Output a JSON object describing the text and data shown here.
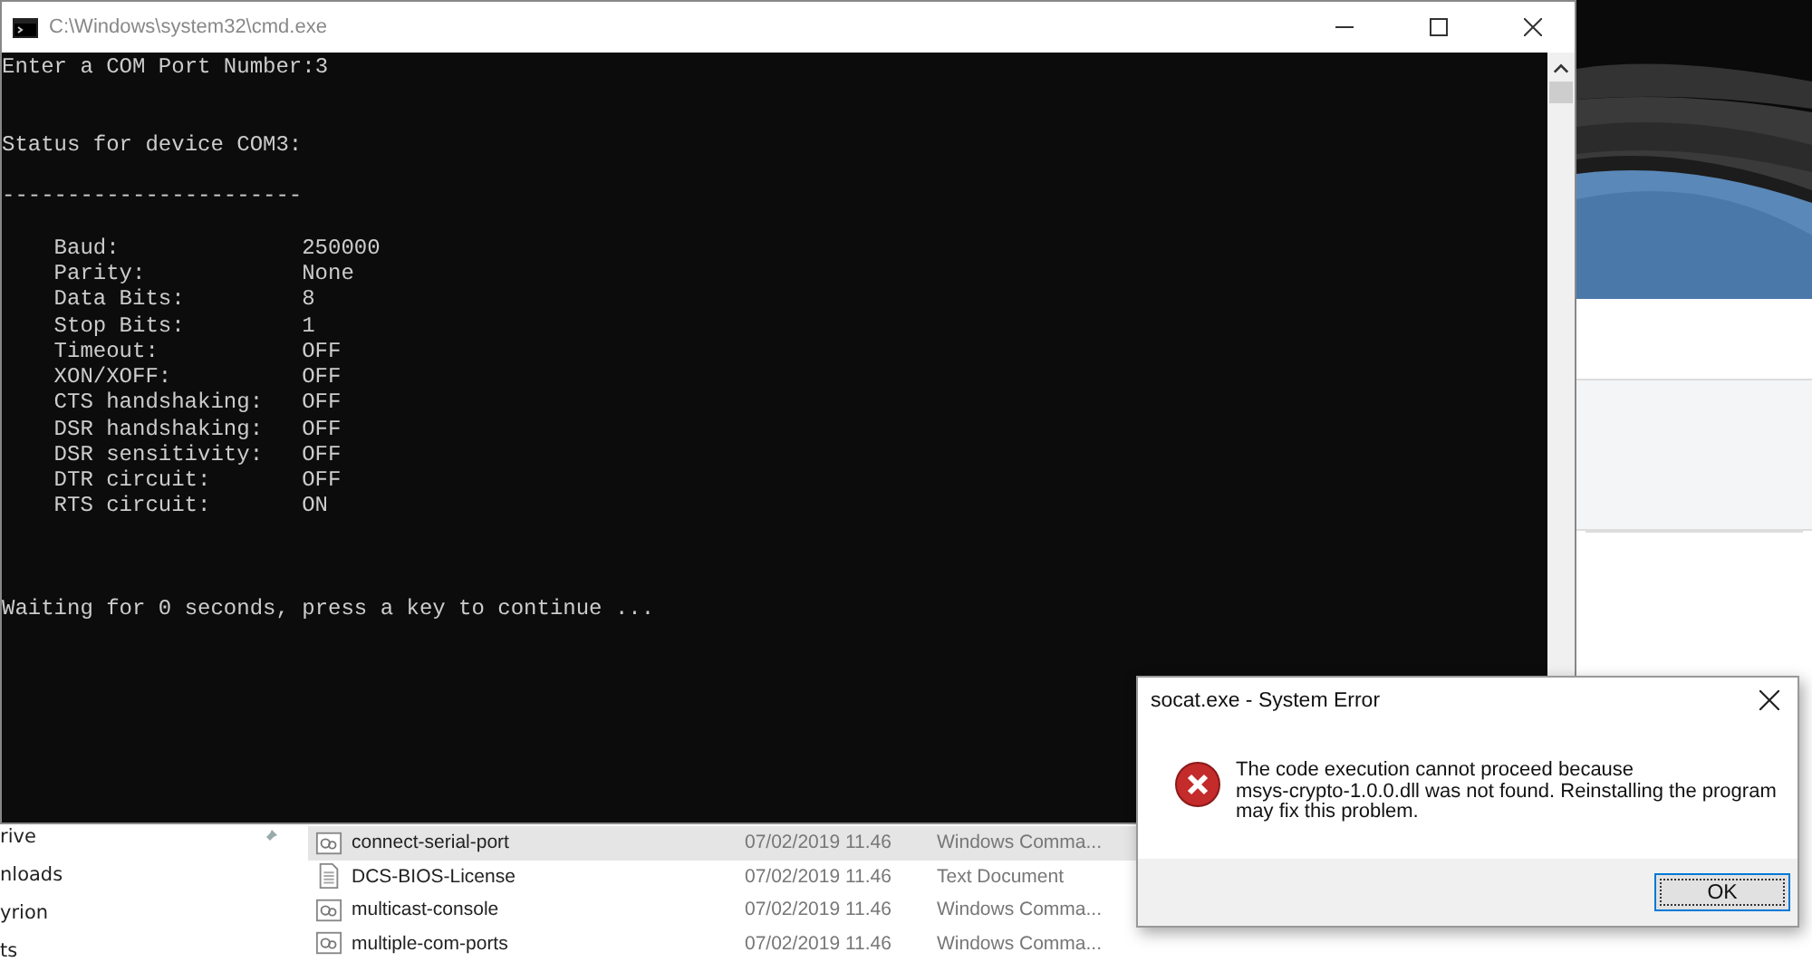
{
  "explorer": {
    "nav_items": [
      {
        "label": "rive",
        "pinned": true
      },
      {
        "label": "nloads",
        "pinned": false
      },
      {
        "label": "yrion",
        "pinned": false
      },
      {
        "label": "ts",
        "pinned": false
      }
    ],
    "files": [
      {
        "name": "connect-serial-port",
        "modified": "07/02/2019 11.46",
        "type": "Windows Comma...",
        "kind": "script",
        "selected": true
      },
      {
        "name": "DCS-BIOS-License",
        "modified": "07/02/2019 11.46",
        "type": "Text Document",
        "kind": "text",
        "selected": false
      },
      {
        "name": "multicast-console",
        "modified": "07/02/2019 11.46",
        "type": "Windows Comma...",
        "kind": "script",
        "selected": false
      },
      {
        "name": "multiple-com-ports",
        "modified": "07/02/2019 11.46",
        "type": "Windows Comma...",
        "kind": "script",
        "selected": false
      }
    ]
  },
  "console_window": {
    "title": "C:\\Windows\\system32\\cmd.exe",
    "prompt": "Enter a COM Port Number:3",
    "status_heading": "Status for device COM3:",
    "rule": "-----------------------",
    "settings": [
      {
        "name": "Baud:",
        "value": "250000"
      },
      {
        "name": "Parity:",
        "value": "None"
      },
      {
        "name": "Data Bits:",
        "value": "8"
      },
      {
        "name": "Stop Bits:",
        "value": "1"
      },
      {
        "name": "Timeout:",
        "value": "OFF"
      },
      {
        "name": "XON/XOFF:",
        "value": "OFF"
      },
      {
        "name": "CTS handshaking:",
        "value": "OFF"
      },
      {
        "name": "DSR handshaking:",
        "value": "OFF"
      },
      {
        "name": "DSR sensitivity:",
        "value": "OFF"
      },
      {
        "name": "DTR circuit:",
        "value": "OFF"
      },
      {
        "name": "RTS circuit:",
        "value": "ON"
      }
    ],
    "waiting": "Waiting for 0 seconds, press a key to continue ..."
  },
  "dialog": {
    "title": "socat.exe - System Error",
    "message_lines": [
      "The code execution cannot proceed because",
      "msys-crypto-1.0.0.dll was not found. Reinstalling the program",
      "may fix this problem."
    ],
    "buttons": [
      {
        "label": "OK",
        "focused": true
      }
    ]
  }
}
